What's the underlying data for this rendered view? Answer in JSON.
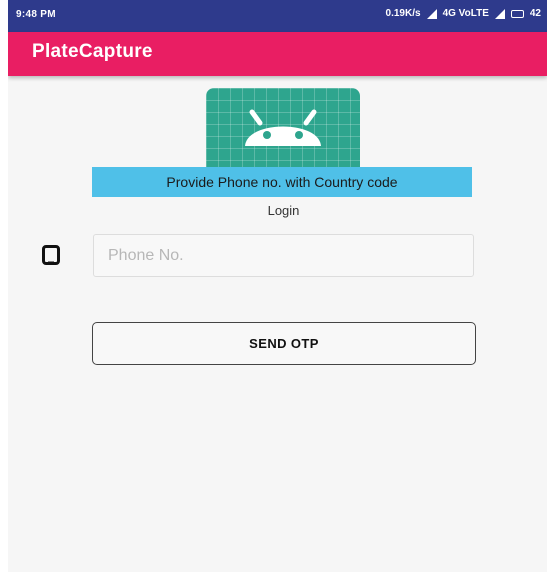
{
  "status_bar": {
    "time": "9:48 PM",
    "network_speed": "0.19K/s",
    "network_type": "4G VoLTE",
    "battery": "42",
    "color": "#2e3a8c"
  },
  "app_bar": {
    "title": "PlateCapture",
    "color": "#e91e63"
  },
  "logo": {
    "icon": "android-icon",
    "color": "#2ea58e"
  },
  "info_banner": {
    "text": "Provide Phone no. with Country code",
    "color": "#4fc0e8"
  },
  "login": {
    "label": "Login",
    "phone_icon": "smartphone-icon",
    "phone_placeholder": "Phone No.",
    "phone_value": "",
    "send_button_label": "SEND OTP"
  }
}
